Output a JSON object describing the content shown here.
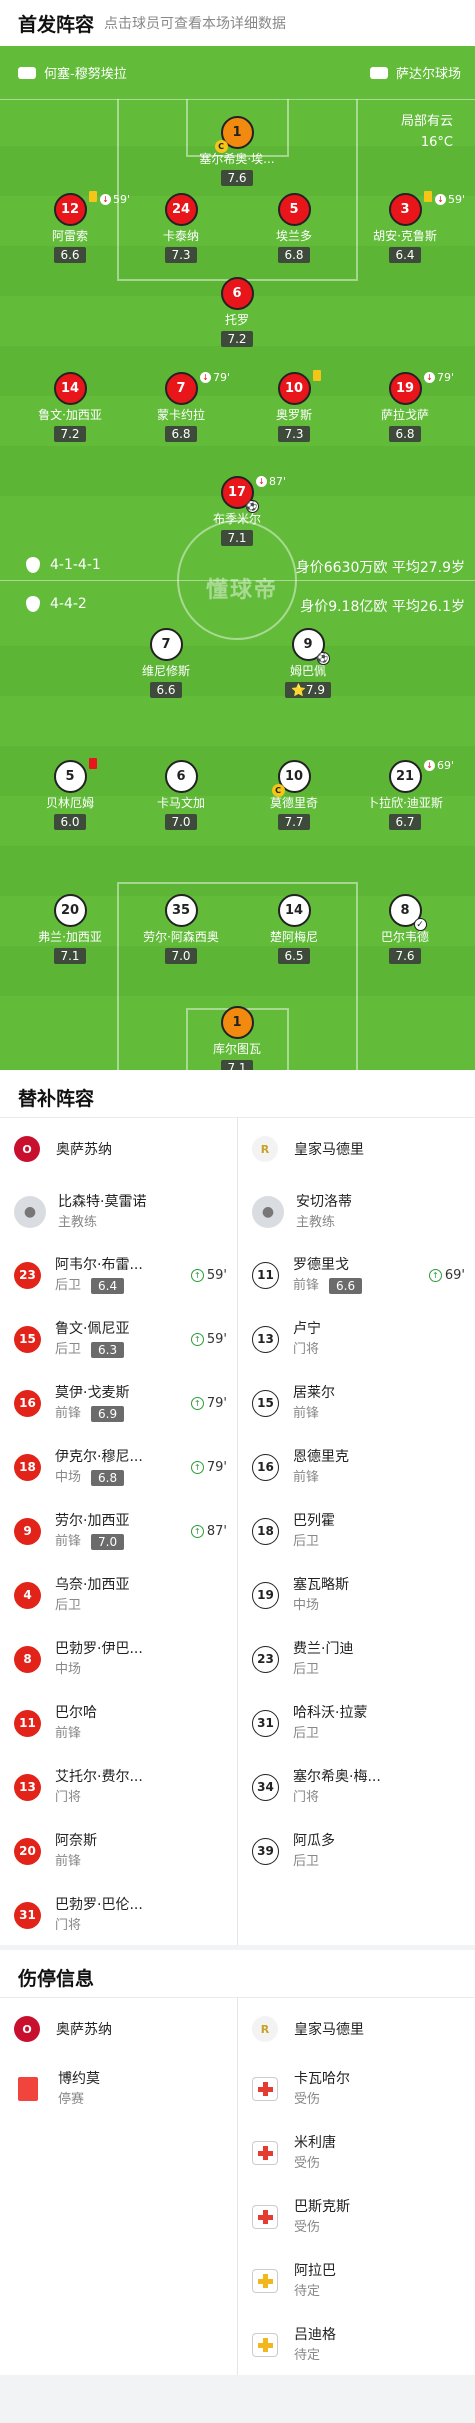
{
  "header": {
    "title": "首发阵容",
    "subtitle": "点击球员可查看本场详细数据"
  },
  "pitch": {
    "home_team": "何塞-穆努埃拉",
    "away_team": "萨达尔球场",
    "weather": "局部有云",
    "temperature": "16°C",
    "home_formation": "4-1-4-1",
    "home_value": "身价6630万欧 平均27.9岁",
    "away_formation": "4-4-2",
    "away_value": "身价9.18亿欧 平均26.1岁",
    "watermark": "懂球帝",
    "players": [
      {
        "num": "1",
        "name": "塞尔希奥·埃...",
        "rating": "7.6",
        "color": "o"
      },
      {
        "num": "12",
        "name": "阿雷索",
        "rating": "6.6",
        "color": "r",
        "card": "yellow",
        "sub": "59'"
      },
      {
        "num": "24",
        "name": "卡泰纳",
        "rating": "7.3",
        "color": "r"
      },
      {
        "num": "5",
        "name": "埃兰多",
        "rating": "6.8",
        "color": "r"
      },
      {
        "num": "3",
        "name": "胡安·克鲁斯",
        "rating": "6.4",
        "color": "r",
        "card": "yellow",
        "sub": "59'"
      },
      {
        "num": "6",
        "name": "托罗",
        "rating": "7.2",
        "color": "r"
      },
      {
        "num": "14",
        "name": "鲁文·加西亚",
        "rating": "7.2",
        "color": "r"
      },
      {
        "num": "7",
        "name": "蒙卡约拉",
        "rating": "6.8",
        "color": "r",
        "sub": "79'"
      },
      {
        "num": "10",
        "name": "奥罗斯",
        "rating": "7.3",
        "color": "r",
        "card": "yellow"
      },
      {
        "num": "19",
        "name": "萨拉戈萨",
        "rating": "6.8",
        "color": "r",
        "sub": "79'"
      },
      {
        "num": "17",
        "name": "布季米尔",
        "rating": "7.1",
        "color": "r",
        "sub": "87'"
      },
      {
        "num": "7",
        "name": "维尼修斯",
        "rating": "6.6",
        "color": "w"
      },
      {
        "num": "9",
        "name": "姆巴佩",
        "rating": "7.9",
        "color": "w"
      },
      {
        "num": "5",
        "name": "贝林厄姆",
        "rating": "6.0",
        "color": "w",
        "card": "red"
      },
      {
        "num": "6",
        "name": "卡马文加",
        "rating": "7.0",
        "color": "w"
      },
      {
        "num": "10",
        "name": "莫德里奇",
        "rating": "7.7",
        "color": "w"
      },
      {
        "num": "21",
        "name": "卜拉欣·迪亚斯",
        "rating": "6.7",
        "color": "w",
        "sub": "69'"
      },
      {
        "num": "20",
        "name": "弗兰·加西亚",
        "rating": "7.1",
        "color": "w"
      },
      {
        "num": "35",
        "name": "劳尔·阿森西奥",
        "rating": "7.0",
        "color": "w"
      },
      {
        "num": "14",
        "name": "楚阿梅尼",
        "rating": "6.5",
        "color": "w"
      },
      {
        "num": "8",
        "name": "巴尔韦德",
        "rating": "7.6",
        "color": "w"
      },
      {
        "num": "1",
        "name": "库尔图瓦",
        "rating": "7.1",
        "color": "o"
      }
    ]
  },
  "subs": {
    "title": "替补阵容",
    "home": {
      "team": "奥萨苏纳",
      "coach": "比森特·莫雷诺",
      "coach_role": "主教练",
      "players": [
        {
          "num": "23",
          "name": "阿韦尔·布雷...",
          "pos": "后卫",
          "rating": "6.4",
          "min": "59'"
        },
        {
          "num": "15",
          "name": "鲁文·佩尼亚",
          "pos": "后卫",
          "rating": "6.3",
          "min": "59'"
        },
        {
          "num": "16",
          "name": "莫伊·戈麦斯",
          "pos": "前锋",
          "rating": "6.9",
          "min": "79'"
        },
        {
          "num": "18",
          "name": "伊克尔·穆尼...",
          "pos": "中场",
          "rating": "6.8",
          "min": "79'"
        },
        {
          "num": "9",
          "name": "劳尔·加西亚",
          "pos": "前锋",
          "rating": "7.0",
          "min": "87'"
        },
        {
          "num": "4",
          "name": "乌奈·加西亚",
          "pos": "后卫"
        },
        {
          "num": "8",
          "name": "巴勃罗·伊巴...",
          "pos": "中场"
        },
        {
          "num": "11",
          "name": "巴尔哈",
          "pos": "前锋"
        },
        {
          "num": "13",
          "name": "艾托尔·费尔...",
          "pos": "门将"
        },
        {
          "num": "20",
          "name": "阿奈斯",
          "pos": "前锋"
        },
        {
          "num": "31",
          "name": "巴勃罗·巴伦...",
          "pos": "门将"
        }
      ]
    },
    "away": {
      "team": "皇家马德里",
      "coach": "安切洛蒂",
      "coach_role": "主教练",
      "players": [
        {
          "num": "11",
          "name": "罗德里戈",
          "pos": "前锋",
          "rating": "6.6",
          "min": "69'"
        },
        {
          "num": "13",
          "name": "卢宁",
          "pos": "门将"
        },
        {
          "num": "15",
          "name": "居莱尔",
          "pos": "前锋"
        },
        {
          "num": "16",
          "name": "恩德里克",
          "pos": "前锋"
        },
        {
          "num": "18",
          "name": "巴列霍",
          "pos": "后卫"
        },
        {
          "num": "19",
          "name": "塞瓦略斯",
          "pos": "中场"
        },
        {
          "num": "23",
          "name": "费兰·门迪",
          "pos": "后卫"
        },
        {
          "num": "31",
          "name": "哈科沃·拉蒙",
          "pos": "后卫"
        },
        {
          "num": "34",
          "name": "塞尔希奥·梅...",
          "pos": "门将"
        },
        {
          "num": "39",
          "name": "阿瓜多",
          "pos": "后卫"
        }
      ]
    }
  },
  "injuries": {
    "title": "伤停信息",
    "home": {
      "team": "奥萨苏纳",
      "players": [
        {
          "name": "博约莫",
          "status": "停赛"
        }
      ]
    },
    "away": {
      "team": "皇家马德里",
      "players": [
        {
          "name": "卡瓦哈尔",
          "status": "受伤"
        },
        {
          "name": "米利唐",
          "status": "受伤"
        },
        {
          "name": "巴斯克斯",
          "status": "受伤"
        },
        {
          "name": "阿拉巴",
          "status": "待定"
        },
        {
          "name": "吕迪格",
          "status": "待定"
        }
      ]
    }
  },
  "colors": {
    "pitch": "#62bc3a",
    "home_red": "#e8161b",
    "keeper": "#f28a10"
  }
}
